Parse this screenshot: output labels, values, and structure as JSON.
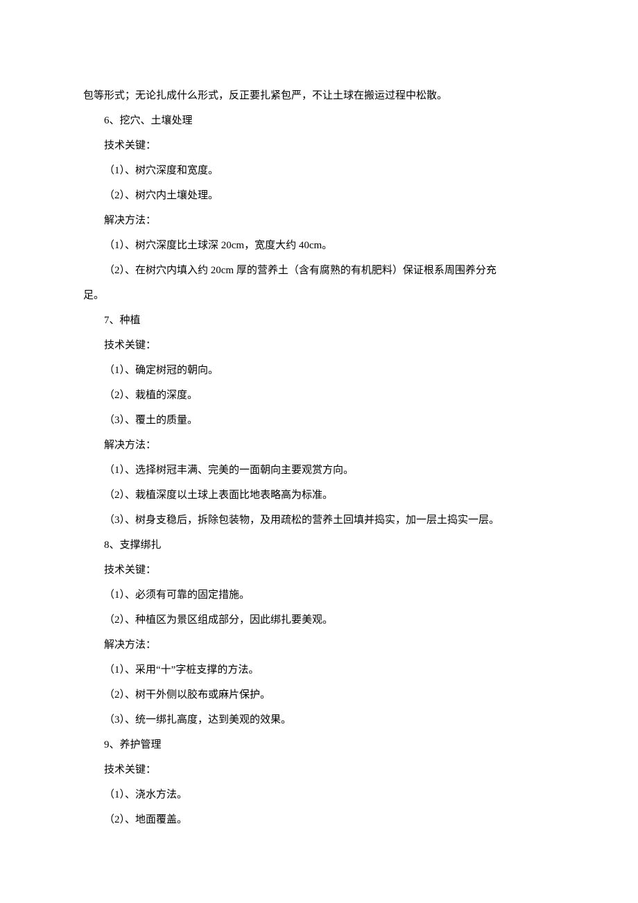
{
  "lines": {
    "l0": "包等形式；无论扎成什么形式，反正要扎紧包严，不让土球在搬运过程中松散。",
    "l1": "6、挖穴、土壤处理",
    "l2": "技术关键：",
    "l3": "（1）、树穴深度和宽度。",
    "l4": "（2）、树穴内土壤处理。",
    "l5": "解决方法：",
    "l6": "（1）、树穴深度比土球深 20cm，宽度大约 40cm。",
    "l7": "（2）、在树穴内填入约 20cm 厚的营养土（含有腐熟的有机肥料）保证根系周围养分充",
    "l8": "足。",
    "l9": "7、种植",
    "l10": "技术关键：",
    "l11": "（1）、确定树冠的朝向。",
    "l12": "（2）、栽植的深度。",
    "l13": "（3）、覆土的质量。",
    "l14": "解决方法：",
    "l15": "（1）、选择树冠丰满、完美的一面朝向主要观赏方向。",
    "l16": "（2）、栽植深度以土球上表面比地表略高为标准。",
    "l17": "（3）、树身支稳后，拆除包装物，及用疏松的营养土回填并捣实，加一层土捣实一层。",
    "l18": "8、支撑绑扎",
    "l19": "技术关键：",
    "l20": "（1）、必须有可靠的固定措施。",
    "l21": "（2）、种植区为景区组成部分，因此绑扎要美观。",
    "l22": "解决方法：",
    "l23": "（1）、采用“十”字桩支撑的方法。",
    "l24": "（2）、树干外侧以胶布或麻片保护。",
    "l25": "（3）、统一绑扎高度，达到美观的效果。",
    "l26": "9、养护管理",
    "l27": "技术关键：",
    "l28": "（1）、浇水方法。",
    "l29": "（2）、地面覆盖。"
  }
}
